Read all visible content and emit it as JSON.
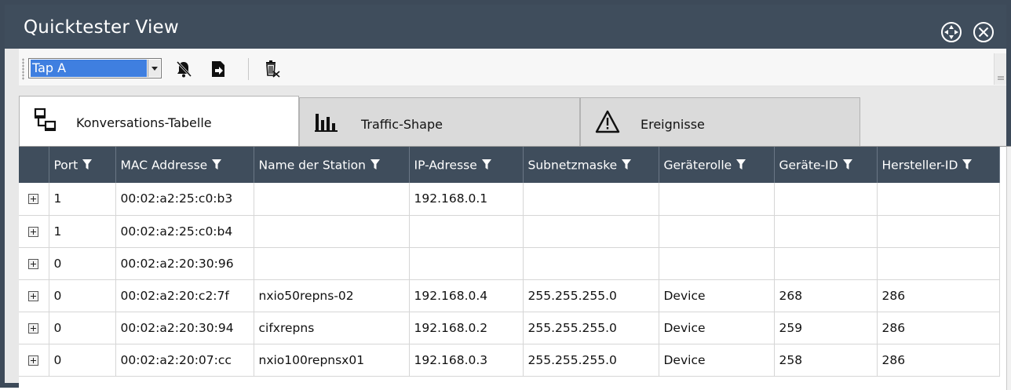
{
  "window": {
    "title": "Quicktester View",
    "accent": "#3f4d5c"
  },
  "toolbar": {
    "tap_select": {
      "value": "Tap A",
      "options_visible": [
        "Tap A"
      ]
    },
    "icons": [
      "bell-off-icon",
      "export-icon",
      "delete-icon"
    ]
  },
  "tabs": [
    {
      "label": "Konversations-Tabelle",
      "icon": "network-icon",
      "active": true
    },
    {
      "label": "Traffic-Shape",
      "icon": "bar-chart-icon",
      "active": false
    },
    {
      "label": "Ereignisse",
      "icon": "warning-icon",
      "active": false
    }
  ],
  "table": {
    "columns": [
      "Port",
      "MAC Addresse",
      "Name der Station",
      "IP-Adresse",
      "Subnetzmaske",
      "Geräterolle",
      "Geräte-ID",
      "Hersteller-ID"
    ],
    "rows": [
      [
        "1",
        "00:02:a2:25:c0:b3",
        "",
        "192.168.0.1",
        "",
        "",
        "",
        ""
      ],
      [
        "1",
        "00:02:a2:25:c0:b4",
        "",
        "",
        "",
        "",
        "",
        ""
      ],
      [
        "0",
        "00:02:a2:20:30:96",
        "",
        "",
        "",
        "",
        "",
        ""
      ],
      [
        "0",
        "00:02:a2:20:c2:7f",
        "nxio50repns-02",
        "192.168.0.4",
        "255.255.255.0",
        "Device",
        "268",
        "286"
      ],
      [
        "0",
        "00:02:a2:20:30:94",
        "cifxrepns",
        "192.168.0.2",
        "255.255.255.0",
        "Device",
        "259",
        "286"
      ],
      [
        "0",
        "00:02:a2:20:07:cc",
        "nxio100repnsx01",
        "192.168.0.3",
        "255.255.255.0",
        "Device",
        "258",
        "286"
      ]
    ]
  }
}
